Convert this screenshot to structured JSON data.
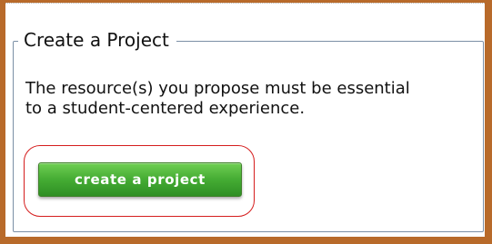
{
  "panel": {
    "title": "Create a Project",
    "description": "The resource(s) you propose must be essential to a student-centered experience.",
    "button_label": "create a project"
  },
  "colors": {
    "outer_frame": "#b86a2a",
    "button_green": "#46ad34",
    "highlight_ring": "#d51d1d",
    "panel_border": "#7b8fa6"
  }
}
